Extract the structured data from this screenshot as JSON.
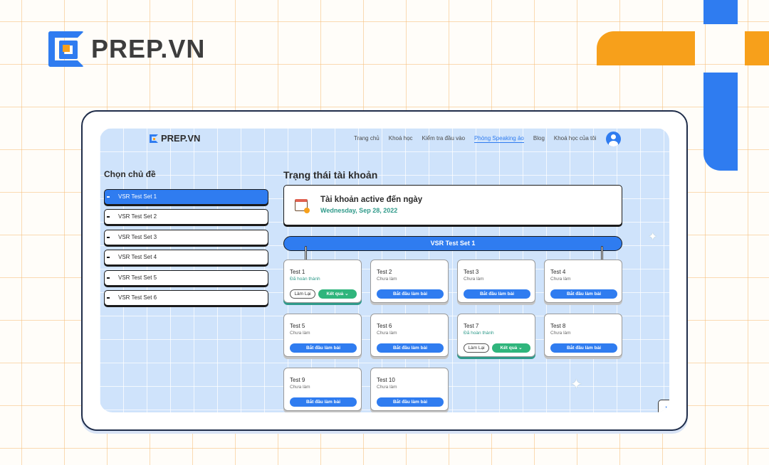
{
  "brand": {
    "name": "PREP.VN"
  },
  "app": {
    "logo": "PREP.VN",
    "nav": [
      "Trang chủ",
      "Khoá học",
      "Kiểm tra đầu vào",
      "Phòng Speaking ảo",
      "Blog",
      "Khoá học của tôi"
    ],
    "nav_active": "Phòng Speaking ảo"
  },
  "sidebar": {
    "title": "Chọn chủ đề",
    "items": [
      "VSR Test Set 1",
      "VSR Test Set 2",
      "VSR Test Set 3",
      "VSR Test Set 4",
      "VSR Test Set 5",
      "VSR Test Set 6"
    ],
    "selected": "VSR Test Set 1"
  },
  "account": {
    "section_title": "Trạng thái tài khoản",
    "label": "Tài khoản active đến ngày",
    "date": "Wednesday, Sep 28, 2022"
  },
  "set_banner": "VSR Test Set 1",
  "buttons": {
    "start": "Bắt đầu làm bài",
    "redo": "Làm Lại",
    "result": "Kết quả"
  },
  "tests": [
    {
      "name": "Test 1",
      "status": "Đã hoàn thành",
      "done": true
    },
    {
      "name": "Test 2",
      "status": "Chưa làm",
      "done": false
    },
    {
      "name": "Test 3",
      "status": "Chưa làm",
      "done": false
    },
    {
      "name": "Test 4",
      "status": "Chưa làm",
      "done": false
    },
    {
      "name": "Test 5",
      "status": "Chưa làm",
      "done": false
    },
    {
      "name": "Test 6",
      "status": "Chưa làm",
      "done": false
    },
    {
      "name": "Test 7",
      "status": "Đã hoàn thành",
      "done": true
    },
    {
      "name": "Test 8",
      "status": "Chưa làm",
      "done": false
    },
    {
      "name": "Test 9",
      "status": "Chưa làm",
      "done": false
    },
    {
      "name": "Test 10",
      "status": "Chưa làm",
      "done": false
    }
  ],
  "colors": {
    "primary": "#2f7cf0",
    "accent": "#f7a01b",
    "success": "#2fb57c"
  }
}
